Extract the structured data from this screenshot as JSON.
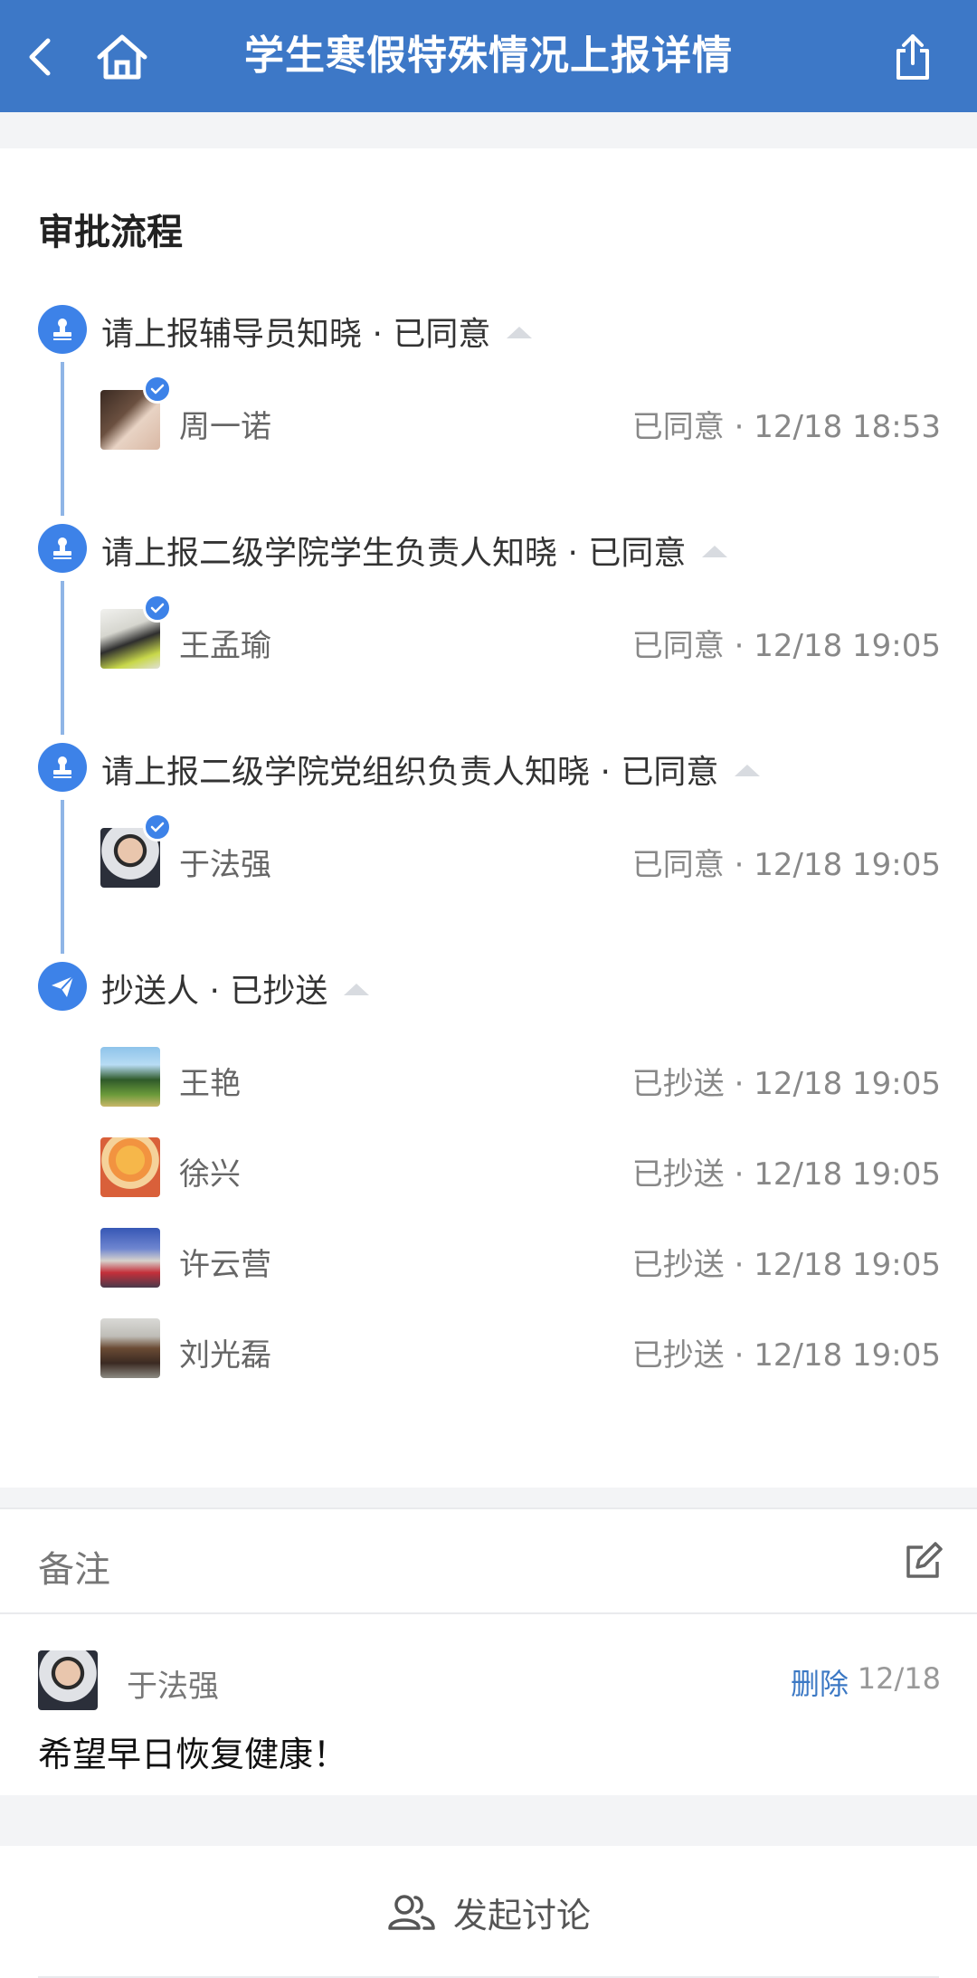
{
  "header": {
    "title": "学生寒假特殊情况上报详情",
    "back_icon": "chevron-left-icon",
    "home_icon": "home-icon",
    "share_icon": "share-icon"
  },
  "flow": {
    "section_title": "审批流程",
    "steps": [
      {
        "title": "请上报辅导员知晓 · 已同意",
        "icon": "stamp-icon",
        "people": [
          {
            "name": "周一诺",
            "status": "已同意 · 12/18 18:53",
            "approved": true
          }
        ]
      },
      {
        "title": "请上报二级学院学生负责人知晓 · 已同意",
        "icon": "stamp-icon",
        "people": [
          {
            "name": "王孟瑜",
            "status": "已同意 · 12/18 19:05",
            "approved": true
          }
        ]
      },
      {
        "title": "请上报二级学院党组织负责人知晓 · 已同意",
        "icon": "stamp-icon",
        "people": [
          {
            "name": "于法强",
            "status": "已同意 · 12/18 19:05",
            "approved": true
          }
        ]
      },
      {
        "title": "抄送人 · 已抄送",
        "icon": "send-icon",
        "people": [
          {
            "name": "王艳",
            "status": "已抄送 · 12/18 19:05"
          },
          {
            "name": "徐兴",
            "status": "已抄送 · 12/18 19:05"
          },
          {
            "name": "许云营",
            "status": "已抄送 · 12/18 19:05"
          },
          {
            "name": "刘光磊",
            "status": "已抄送 · 12/18 19:05"
          }
        ]
      }
    ]
  },
  "note": {
    "label": "备注",
    "edit_icon": "edit-icon",
    "author": "于法强",
    "delete_label": "删除",
    "date": "12/18",
    "text": "希望早日恢复健康！"
  },
  "discuss": {
    "label": "发起讨论",
    "icon": "users-icon"
  },
  "colors": {
    "header_bg": "#3d78c7",
    "accent": "#3d82e8",
    "timeline": "#8fb5e6",
    "link": "#3b78c4"
  }
}
